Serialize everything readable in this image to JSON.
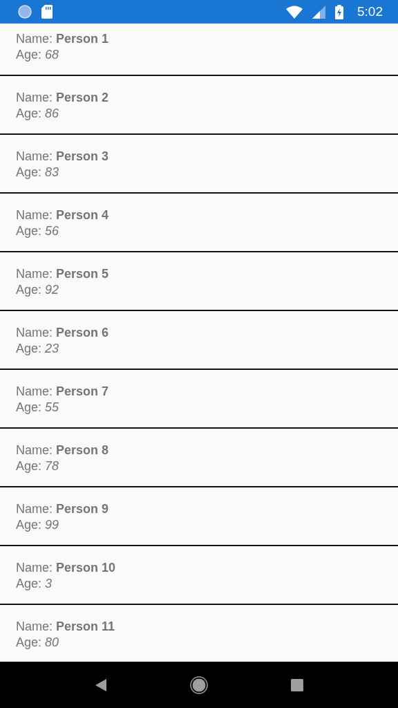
{
  "status_bar": {
    "time": "5:02"
  },
  "people": [
    {
      "name": "Name: **Person 1**",
      "age": "Age: *68*"
    },
    {
      "name": "Name: **Person 2**",
      "age": "Age: *86*"
    },
    {
      "name": "Name: **Person 3**",
      "age": "Age: *83*"
    },
    {
      "name": "Name: **Person 4**",
      "age": "Age: *56*"
    },
    {
      "name": "Name: **Person 5**",
      "age": "Age: *92*"
    },
    {
      "name": "Name: **Person 6**",
      "age": "Age: *23*"
    },
    {
      "name": "Name: **Person 7**",
      "age": "Age: *55*"
    },
    {
      "name": "Name: **Person 8**",
      "age": "Age: *78*"
    },
    {
      "name": "Name: **Person 9**",
      "age": "Age: *99*"
    },
    {
      "name": "Name: **Person 10**",
      "age": "Age: *3*"
    },
    {
      "name": "Name: **Person 11**",
      "age": "Age: *80*"
    }
  ]
}
